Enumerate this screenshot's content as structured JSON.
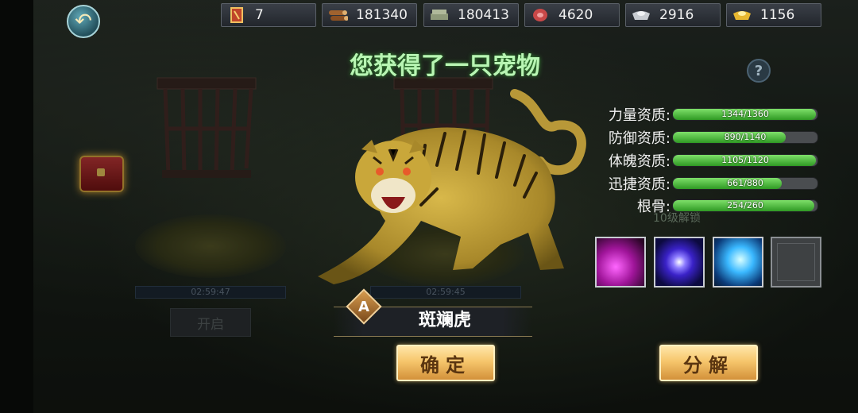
{
  "resources": [
    {
      "icon": "scroll-token-icon",
      "value": "7"
    },
    {
      "icon": "wood-logs-icon",
      "value": "181340"
    },
    {
      "icon": "stone-slab-icon",
      "value": "180413"
    },
    {
      "icon": "meat-icon",
      "value": "4620"
    },
    {
      "icon": "silver-ingot-icon",
      "value": "2916"
    },
    {
      "icon": "gold-ingot-icon",
      "value": "1156"
    }
  ],
  "title": "您获得了一只宠物",
  "help_label": "?",
  "left_pen": {
    "timer": "02:59:47",
    "open_label": "开启"
  },
  "center_pen": {
    "timer": "02:59:45"
  },
  "faded_text": "10级解锁",
  "stats": [
    {
      "label": "力量资质:",
      "current": 1344,
      "max": 1360,
      "text": "1344/1360"
    },
    {
      "label": "防御资质:",
      "current": 890,
      "max": 1140,
      "text": "890/1140"
    },
    {
      "label": "体魄资质:",
      "current": 1105,
      "max": 1120,
      "text": "1105/1120"
    },
    {
      "label": "迅捷资质:",
      "current": 661,
      "max": 880,
      "text": "661/880"
    },
    {
      "label": "根骨:",
      "current": 254,
      "max": 260,
      "text": "254/260"
    }
  ],
  "skills": [
    "pink-lightning-skill",
    "purple-orb-skill",
    "blue-lightning-skill",
    "empty-slot"
  ],
  "pet": {
    "grade": "A",
    "name": "斑斓虎"
  },
  "buttons": {
    "confirm": "确定",
    "decompose": "分解"
  },
  "colors": {
    "title_glow": "#b8f5b3",
    "bar_fill": "#3faa2e",
    "button_gold": "#f6c66c"
  }
}
